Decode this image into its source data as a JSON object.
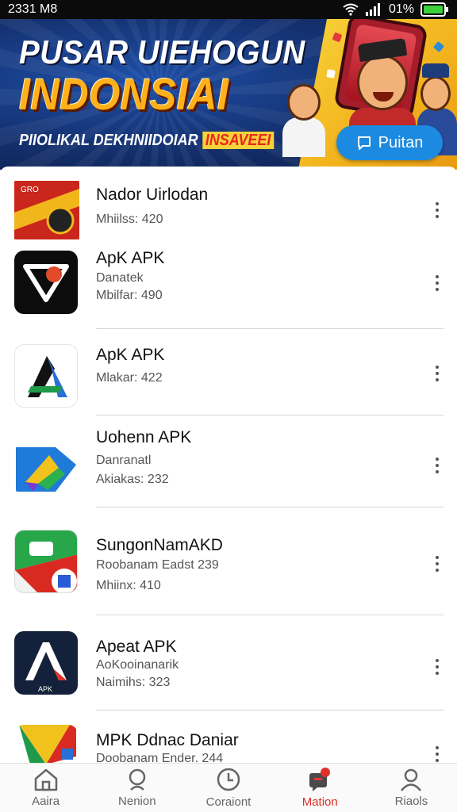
{
  "status_bar": {
    "time": "2331 M8",
    "battery": "01%"
  },
  "banner": {
    "title_line1": "PUSAR UIEHOGUN",
    "title_line2": "INDONSIAI",
    "subtitle": "PIIOLIKAL DEKHNIIDOIAR",
    "highlight": "INSAVEEI",
    "button_label": "Puitan"
  },
  "apps": [
    {
      "title": "Nador Uirlodan",
      "subtitle": "",
      "meta": "Mhiilss: 420",
      "icon": "red-banner-app-icon"
    },
    {
      "title": "ApK APK",
      "subtitle": "Danatek",
      "meta": "Mbilfar: 490",
      "icon": "black-triangle-app-icon"
    },
    {
      "title": "ApK APK",
      "subtitle": "",
      "meta": "Mlakar: 422",
      "icon": "blue-green-a-app-icon"
    },
    {
      "title": "Uohenn APK",
      "subtitle": "Danranatl",
      "meta": "Akiakas: 232",
      "icon": "blue-arrow-app-icon"
    },
    {
      "title": "SungonNamAKD",
      "subtitle": "Roobanam Eadst 239",
      "meta": "Mhiinx: 410",
      "icon": "green-red-app-icon"
    },
    {
      "title": "Apeat APK",
      "subtitle": "AoKooinanarik",
      "meta": "Naimihs: 323",
      "icon": "navy-a-app-icon"
    },
    {
      "title": "MPK Ddnac Daniar",
      "subtitle": "Doobanam Ender. 244",
      "meta": "",
      "icon": "yellow-green-app-icon"
    }
  ],
  "nav": {
    "items": [
      {
        "label": "Aaira",
        "icon": "home-icon"
      },
      {
        "label": "Nenion",
        "icon": "search-icon"
      },
      {
        "label": "Coraiont",
        "icon": "clock-icon"
      },
      {
        "label": "Mation",
        "icon": "notification-icon",
        "active": true
      },
      {
        "label": "Riaols",
        "icon": "profile-icon"
      }
    ],
    "active_color": "#d9312b"
  }
}
